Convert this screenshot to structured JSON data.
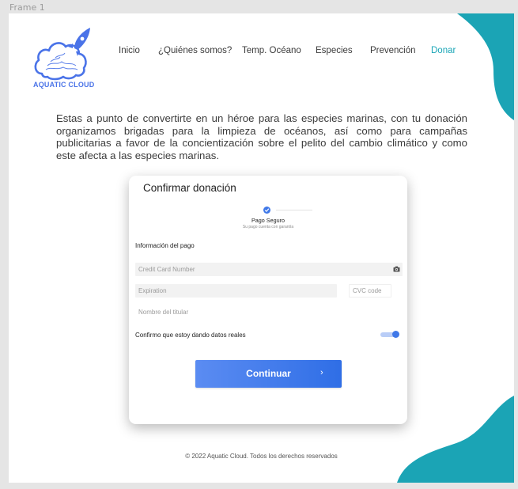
{
  "frame_label": "Frame 1",
  "brand": {
    "name": "AQUATIC CLOUD",
    "color": "#4a73e8",
    "icon": "rocket-cloud-logo"
  },
  "nav": {
    "items": [
      {
        "label": "Inicio",
        "active": false
      },
      {
        "label": "¿Quiénes somos?",
        "active": false
      },
      {
        "label": "Temp. Océano",
        "active": false
      },
      {
        "label": "Especies",
        "active": false
      },
      {
        "label": "Prevención",
        "active": false
      },
      {
        "label": "Donar",
        "active": true
      }
    ],
    "active_color": "#1aa6b7"
  },
  "intro": "Estas a punto de convertirte en un héroe para las especies marinas, con tu donación organizamos brigadas para la limpieza de océanos, así como para campañas publicitarias a favor de la concientización sobre el pelito del cambio climático y como este afecta a las especies marinas.",
  "card": {
    "title": "Confirmar donación",
    "step": {
      "label": "Pago Seguro",
      "sublabel": "Su pago cuenta con garantía",
      "icon": "check-icon"
    },
    "section_title": "Información del pago",
    "fields": {
      "card_number_placeholder": "Credit Card Number",
      "card_icon": "camera-icon",
      "expiration_placeholder": "Expiration",
      "cvc_placeholder": "CVC code",
      "name_placeholder": "Nombre del titular"
    },
    "confirm_label": "Confirmo que estoy dando datos reales",
    "confirm_toggle_on": true,
    "button_label": "Continuar",
    "button_icon": "chevron-right-icon"
  },
  "footer": "© 2022 Aquatic Cloud. Todos los derechos reservados",
  "colors": {
    "accent": "#3f78e8",
    "teal": "#1aa6b7"
  }
}
